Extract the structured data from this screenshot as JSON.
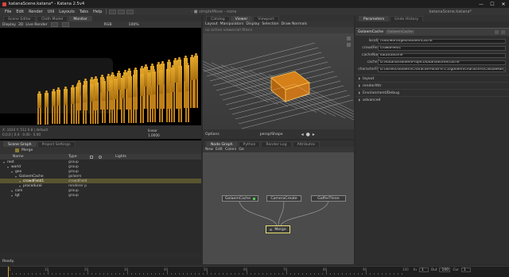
{
  "window": {
    "title": "katanaScene.katana* - Katana 2.5v4",
    "min": "—",
    "max": "☐",
    "close": "✕"
  },
  "menu": [
    "File",
    "Edit",
    "Render",
    "Util",
    "Layouts",
    "Tabs",
    "Help"
  ],
  "menu_right": {
    "scene_label": "katanaScene.katana*",
    "renderer_label": "- ■ simpleMove - none"
  },
  "monitor": {
    "tabs": [
      "Scene Editor",
      "Cloth Model",
      "Monitor"
    ],
    "toolbar": [
      "Display",
      "2D",
      "Live Render"
    ],
    "rgb_label": "RGB",
    "zoom": "100%",
    "footer": {
      "line1": "X: 1024  Y: 512  0.8 | default",
      "line2": "0,0,0 | 0.4  ·  0.00 · 0.00",
      "mode": "linear",
      "value": "1.0000"
    }
  },
  "viewer": {
    "tabs": [
      "Catalog",
      "Viewer",
      "Viewport"
    ],
    "menu": [
      "Layout",
      "Manipulators",
      "Display",
      "Selection",
      "Draw Normals"
    ],
    "warning": "no active viewer/all filters",
    "footer_left": "Options",
    "footer_center": "persp/Shape"
  },
  "scenegraph": {
    "tabs": [
      "Scene Graph",
      "Project Settings"
    ],
    "node_label": "Merge",
    "columns": [
      "Name",
      "Type",
      "Lights"
    ],
    "rows": [
      {
        "name": "root",
        "type": "group",
        "indent": 0,
        "selected": false
      },
      {
        "name": "world",
        "type": "group",
        "indent": 1,
        "selected": false
      },
      {
        "name": "geo",
        "type": "group",
        "indent": 2,
        "selected": false
      },
      {
        "name": "GolaemCache",
        "type": "golaem",
        "indent": 3,
        "selected": false
      },
      {
        "name": "crowdField1",
        "type": "crowdField",
        "indent": 4,
        "selected": true
      },
      {
        "name": "procedural",
        "type": "renderer p",
        "indent": 4,
        "selected": false
      },
      {
        "name": "cam",
        "type": "group",
        "indent": 2,
        "selected": false
      },
      {
        "name": "lgt",
        "type": "group",
        "indent": 2,
        "selected": false
      }
    ],
    "status": "Ready."
  },
  "nodegraph": {
    "tabs": [
      "Node Graph",
      "Python",
      "Render Log",
      "Attributes"
    ],
    "menu": [
      "New",
      "Edit",
      "Colors",
      "Go"
    ],
    "nodes": [
      "GolaemCache",
      "CameraCreate",
      "GafferThree",
      "Merge"
    ]
  },
  "params": {
    "tabs": [
      "Parameters",
      "Undo History"
    ],
    "node_name": "GolaemCache",
    "node_type": "GolaemCache",
    "fields": [
      {
        "label": "location",
        "value": "/root/world/geo/GolaemCache"
      },
      {
        "label": "crowdFields",
        "value": "crowdField1"
      },
      {
        "label": "cacheName",
        "value": "katanaScene"
      },
      {
        "label": "cacheDir",
        "value": "D:/Katana/GolaemProject/katanaScene/cache"
      },
      {
        "label": "characterFiles",
        "value": "D:/assets/Golaem/CharacterPacks-6.1.2/golaem/characters/CasualMan_Light.gcha"
      }
    ],
    "groups": [
      "layout",
      "renderAttr",
      "Environment/Debug",
      "advanced"
    ]
  },
  "timeline": {
    "ticks": [
      "1",
      "10",
      "20",
      "30",
      "40",
      "50",
      "60",
      "70",
      "80",
      "90",
      "100"
    ],
    "in_label": "In",
    "in_value": "1",
    "out_label": "Out",
    "out_value": "100",
    "cur_label": "Cur",
    "cur_value": "1"
  },
  "colors": {
    "accent": "#e0a020",
    "bg": "#2b2b2b",
    "selection": "#5a5530"
  }
}
